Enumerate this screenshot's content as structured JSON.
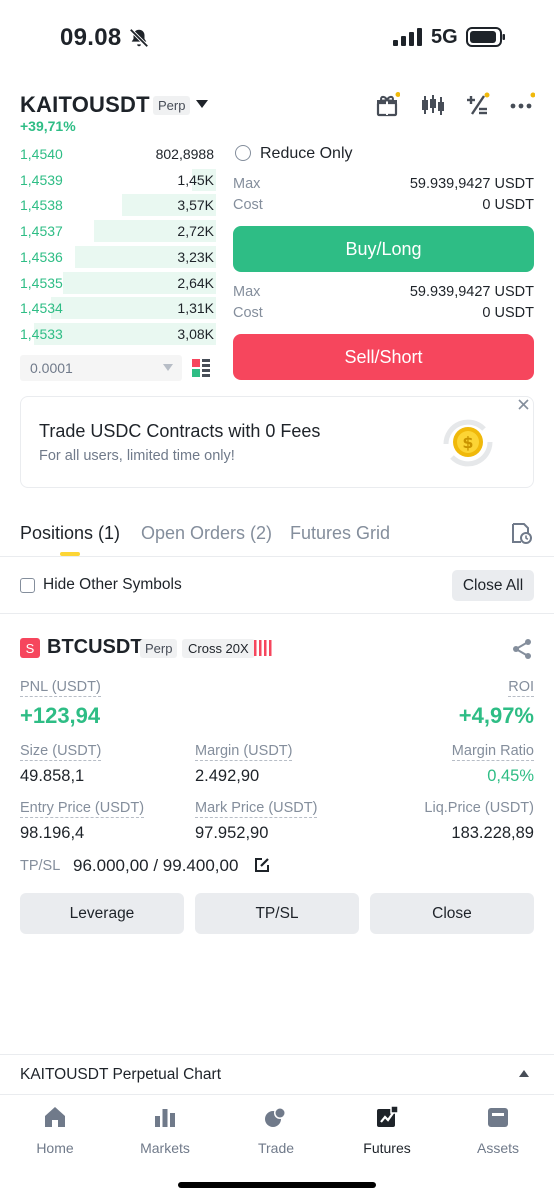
{
  "status_bar": {
    "time": "09.08",
    "network": "5G"
  },
  "header": {
    "pair": "KAITOUSDT",
    "tag": "Perp",
    "change": "+39,71%"
  },
  "orderbook": {
    "rows": [
      {
        "price": "1,4540",
        "qty": "802,8988",
        "depth": 0.0
      },
      {
        "price": "1,4539",
        "qty": "1,45K",
        "depth": 0.12
      },
      {
        "price": "1,4538",
        "qty": "3,57K",
        "depth": 0.48
      },
      {
        "price": "1,4537",
        "qty": "2,72K",
        "depth": 0.62
      },
      {
        "price": "1,4536",
        "qty": "3,23K",
        "depth": 0.72
      },
      {
        "price": "1,4535",
        "qty": "2,64K",
        "depth": 0.78
      },
      {
        "price": "1,4534",
        "qty": "1,31K",
        "depth": 0.84
      },
      {
        "price": "1,4533",
        "qty": "3,08K",
        "depth": 0.93
      }
    ],
    "tick_size": "0.0001"
  },
  "order_form": {
    "reduce_only": "Reduce Only",
    "buy": {
      "max_label": "Max",
      "max_value": "59.939,9427 USDT",
      "cost_label": "Cost",
      "cost_value": "0 USDT",
      "button": "Buy/Long"
    },
    "sell": {
      "max_label": "Max",
      "max_value": "59.939,9427 USDT",
      "cost_label": "Cost",
      "cost_value": "0 USDT",
      "button": "Sell/Short"
    }
  },
  "promo": {
    "title": "Trade USDC Contracts with 0 Fees",
    "subtitle": "For all users, limited time only!"
  },
  "tabs": {
    "positions": "Positions (1)",
    "open_orders": "Open Orders (2)",
    "futures_grid": "Futures Grid"
  },
  "filter": {
    "hide_other": "Hide Other Symbols",
    "close_all": "Close All"
  },
  "position": {
    "badge": "S",
    "symbol": "BTCUSDT",
    "tag": "Perp",
    "mode": "Cross 20X",
    "pnl_label": "PNL (USDT)",
    "pnl_value": "+123,94",
    "roi_label": "ROI",
    "roi_value": "+4,97%",
    "size_label": "Size (USDT)",
    "size_value": "49.858,1",
    "margin_label": "Margin (USDT)",
    "margin_value": "2.492,90",
    "margin_ratio_label": "Margin Ratio",
    "margin_ratio_value": "0,45%",
    "entry_label": "Entry Price (USDT)",
    "entry_value": "98.196,4",
    "mark_label": "Mark Price (USDT)",
    "mark_value": "97.952,90",
    "liq_label": "Liq.Price (USDT)",
    "liq_value": "183.228,89",
    "tpsl_label": "TP/SL",
    "tpsl_value": "96.000,00 / 99.400,00",
    "buttons": {
      "leverage": "Leverage",
      "tpsl": "TP/SL",
      "close": "Close"
    }
  },
  "chart_bar": {
    "label": "KAITOUSDT Perpetual  Chart"
  },
  "nav": {
    "items": [
      {
        "label": "Home"
      },
      {
        "label": "Markets"
      },
      {
        "label": "Trade"
      },
      {
        "label": "Futures"
      },
      {
        "label": "Assets"
      }
    ]
  },
  "colors": {
    "green": "#2ebd85",
    "red": "#f6465d",
    "accent": "#fcd535"
  }
}
